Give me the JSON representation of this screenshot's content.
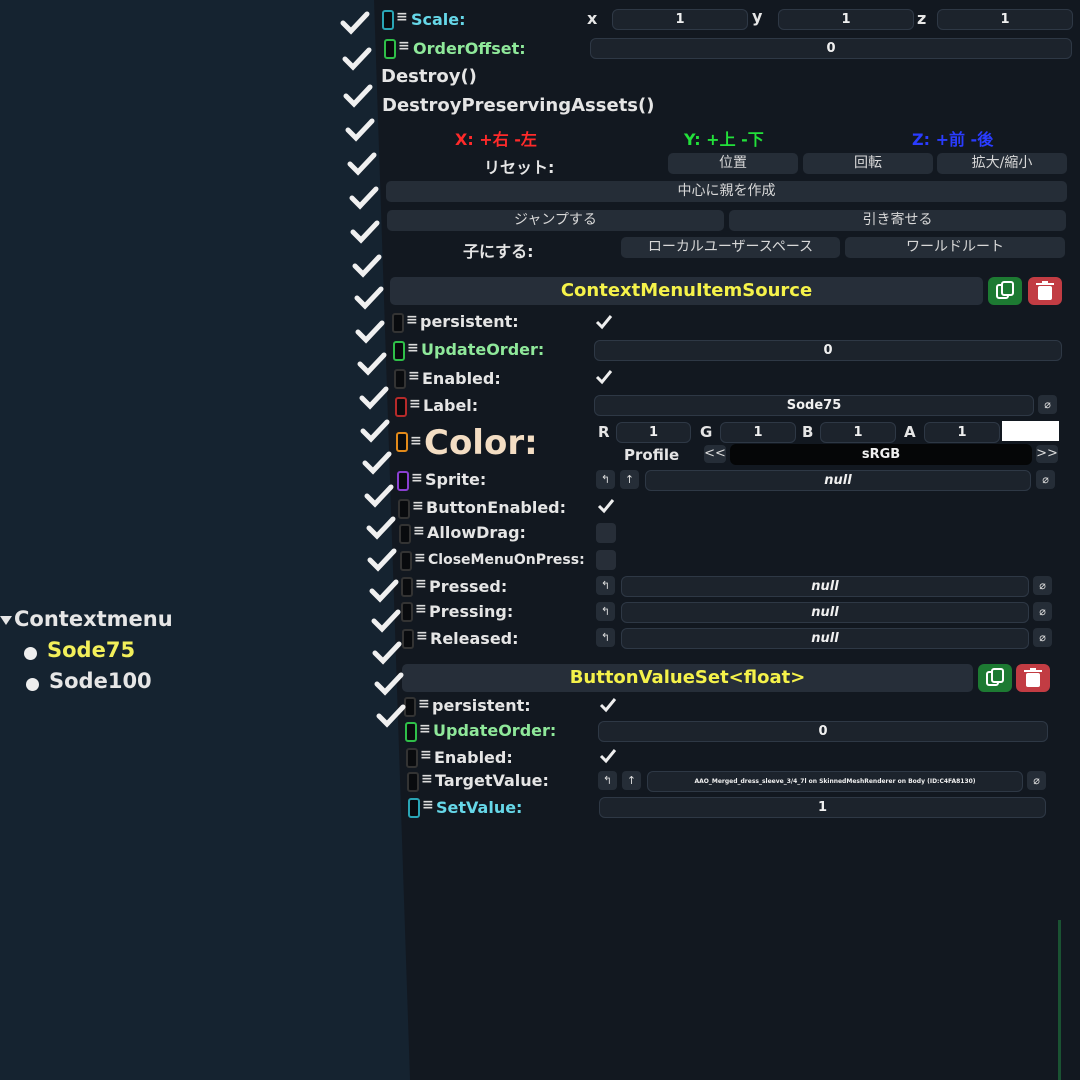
{
  "hierarchy": {
    "root": "Contextmenu",
    "children": [
      "Sode75",
      "Sode100"
    ]
  },
  "scale": {
    "label": "Scale:",
    "x_label": "x",
    "x": "1",
    "y_label": "y",
    "y": "1",
    "z_label": "z",
    "z": "1"
  },
  "order_offset": {
    "label": "OrderOffset:",
    "value": "0"
  },
  "actions": {
    "destroy": "Destroy()",
    "destroy_preserving": "DestroyPreservingAssets()"
  },
  "axes_hint": {
    "x": "X: +右 -左",
    "y": "Y: +上 -下",
    "z": "Z: +前 -後"
  },
  "reset": {
    "label": "リセット:",
    "position": "位置",
    "rotation": "回転",
    "scale": "拡大/縮小"
  },
  "create_parent": "中心に親を作成",
  "jump": "ジャンプする",
  "pull": "引き寄せる",
  "parent_to": {
    "label": "子にする:",
    "local_user_space": "ローカルユーザースペース",
    "world_root": "ワールドルート"
  },
  "component1": {
    "title": "ContextMenuItemSource",
    "persistent": "persistent:",
    "update_order_label": "UpdateOrder:",
    "update_order": "0",
    "enabled": "Enabled:",
    "label_label": "Label:",
    "label_value": "Sode75",
    "color_label": "Color:",
    "r_label": "R",
    "r": "1",
    "g_label": "G",
    "g": "1",
    "b_label": "B",
    "b": "1",
    "a_label": "A",
    "a": "1",
    "profile_label": "Profile",
    "profile_prev": "<<",
    "profile": "sRGB",
    "profile_next": ">>",
    "sprite": "Sprite:",
    "sprite_value": "null",
    "button_enabled": "ButtonEnabled:",
    "allow_drag": "AllowDrag:",
    "close_menu": "CloseMenuOnPress:",
    "pressed": "Pressed:",
    "pressed_value": "null",
    "pressing": "Pressing:",
    "pressing_value": "null",
    "released": "Released:",
    "released_value": "null"
  },
  "component2": {
    "title": "ButtonValueSet<float>",
    "persistent": "persistent:",
    "update_order_label": "UpdateOrder:",
    "update_order": "0",
    "enabled": "Enabled:",
    "target_label": "TargetValue:",
    "target_value": "AAO_Merged_dress_sleeve_3/4_7l on SkinnedMeshRenderer on Body (ID:C4FA8130)",
    "set_value_label": "SetValue:",
    "set_value": "1"
  },
  "colors": {
    "accent_yellow": "#f5f24a",
    "copy_green": "#1d7a32",
    "delete_red": "#c23c43",
    "x_red": "#ff2a2a",
    "y_green": "#22e03a",
    "z_blue": "#2a3cff"
  }
}
